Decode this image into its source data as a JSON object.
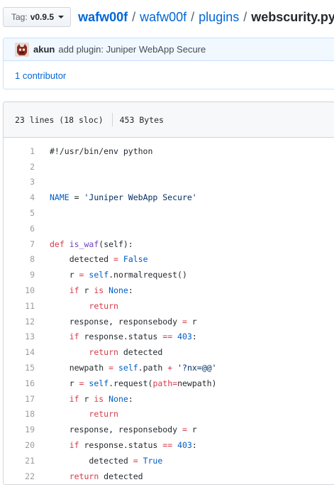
{
  "tag": {
    "prefix": "Tag:",
    "version": "v0.9.5"
  },
  "breadcrumb": {
    "root": "wafw00f",
    "sep1": "/",
    "dir1": "wafw00f",
    "sep2": "/",
    "dir2": "plugins",
    "sep3": "/",
    "file": "webscurity.py"
  },
  "commit": {
    "author": "akun",
    "message": "add plugin: Juniper WebApp Secure"
  },
  "contributors": {
    "label": "1 contributor"
  },
  "file_info": {
    "lines": "23 lines (18 sloc)",
    "size": "453 Bytes"
  },
  "code": [
    {
      "n": "1",
      "t": [
        [
          "#!/usr/bin/env python",
          ""
        ]
      ]
    },
    {
      "n": "2",
      "t": []
    },
    {
      "n": "3",
      "t": []
    },
    {
      "n": "4",
      "t": [
        [
          "NAME",
          "c"
        ],
        [
          " = ",
          ""
        ],
        [
          "'Juniper WebApp Secure'",
          "s"
        ]
      ]
    },
    {
      "n": "5",
      "t": []
    },
    {
      "n": "6",
      "t": []
    },
    {
      "n": "7",
      "t": [
        [
          "def",
          "k"
        ],
        [
          " ",
          ""
        ],
        [
          "is_waf",
          "f"
        ],
        [
          "(self):",
          ""
        ]
      ]
    },
    {
      "n": "8",
      "t": [
        [
          "    detected ",
          ""
        ],
        [
          "=",
          "k"
        ],
        [
          " ",
          ""
        ],
        [
          "False",
          "c"
        ]
      ]
    },
    {
      "n": "9",
      "t": [
        [
          "    r ",
          ""
        ],
        [
          "=",
          "k"
        ],
        [
          " ",
          ""
        ],
        [
          "self",
          "c"
        ],
        [
          ".normalrequest()",
          ""
        ]
      ]
    },
    {
      "n": "10",
      "t": [
        [
          "    ",
          ""
        ],
        [
          "if",
          "k"
        ],
        [
          " r ",
          ""
        ],
        [
          "is",
          "k"
        ],
        [
          " ",
          ""
        ],
        [
          "None",
          "c"
        ],
        [
          ":",
          ""
        ]
      ]
    },
    {
      "n": "11",
      "t": [
        [
          "        ",
          ""
        ],
        [
          "return",
          "k"
        ]
      ]
    },
    {
      "n": "12",
      "t": [
        [
          "    response, responsebody ",
          ""
        ],
        [
          "=",
          "k"
        ],
        [
          " r",
          ""
        ]
      ]
    },
    {
      "n": "13",
      "t": [
        [
          "    ",
          ""
        ],
        [
          "if",
          "k"
        ],
        [
          " response.status ",
          ""
        ],
        [
          "==",
          "k"
        ],
        [
          " ",
          ""
        ],
        [
          "403",
          "c"
        ],
        [
          ":",
          ""
        ]
      ]
    },
    {
      "n": "14",
      "t": [
        [
          "        ",
          ""
        ],
        [
          "return",
          "k"
        ],
        [
          " detected",
          ""
        ]
      ]
    },
    {
      "n": "15",
      "t": [
        [
          "    newpath ",
          ""
        ],
        [
          "=",
          "k"
        ],
        [
          " ",
          ""
        ],
        [
          "self",
          "c"
        ],
        [
          ".path ",
          ""
        ],
        [
          "+",
          "k"
        ],
        [
          " ",
          ""
        ],
        [
          "'?nx=@@'",
          "s"
        ]
      ]
    },
    {
      "n": "16",
      "t": [
        [
          "    r ",
          ""
        ],
        [
          "=",
          "k"
        ],
        [
          " ",
          ""
        ],
        [
          "self",
          "c"
        ],
        [
          ".request(",
          ""
        ],
        [
          "path",
          "k"
        ],
        [
          "=",
          "k"
        ],
        [
          "newpath)",
          ""
        ]
      ]
    },
    {
      "n": "17",
      "t": [
        [
          "    ",
          ""
        ],
        [
          "if",
          "k"
        ],
        [
          " r ",
          ""
        ],
        [
          "is",
          "k"
        ],
        [
          " ",
          ""
        ],
        [
          "None",
          "c"
        ],
        [
          ":",
          ""
        ]
      ]
    },
    {
      "n": "18",
      "t": [
        [
          "        ",
          ""
        ],
        [
          "return",
          "k"
        ]
      ]
    },
    {
      "n": "19",
      "t": [
        [
          "    response, responsebody ",
          ""
        ],
        [
          "=",
          "k"
        ],
        [
          " r",
          ""
        ]
      ]
    },
    {
      "n": "20",
      "t": [
        [
          "    ",
          ""
        ],
        [
          "if",
          "k"
        ],
        [
          " response.status ",
          ""
        ],
        [
          "==",
          "k"
        ],
        [
          " ",
          ""
        ],
        [
          "403",
          "c"
        ],
        [
          ":",
          ""
        ]
      ]
    },
    {
      "n": "21",
      "t": [
        [
          "        detected ",
          ""
        ],
        [
          "=",
          "k"
        ],
        [
          " ",
          ""
        ],
        [
          "True",
          "c"
        ]
      ]
    },
    {
      "n": "22",
      "t": [
        [
          "    ",
          ""
        ],
        [
          "return",
          "k"
        ],
        [
          " detected",
          ""
        ]
      ]
    }
  ]
}
